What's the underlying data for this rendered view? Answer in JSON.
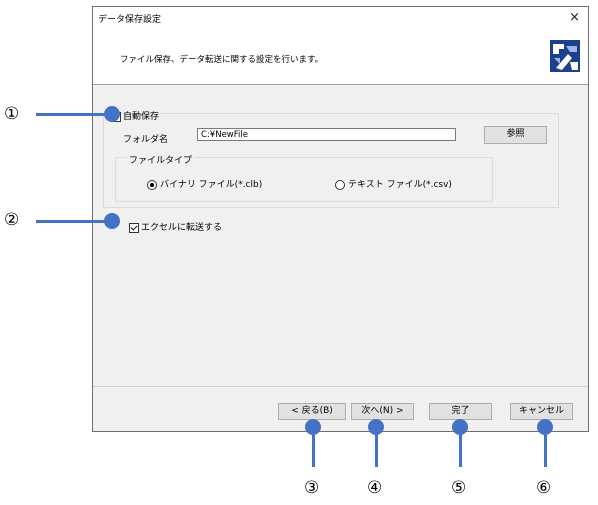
{
  "dialog": {
    "title": "データ保存設定",
    "close": "×",
    "description": "ファイル保存、データ転送に関する設定を行います。",
    "logo": "app-logo-icon"
  },
  "auto_save": {
    "label": "自動保存",
    "checked": true
  },
  "folder": {
    "label": "フォルダ名",
    "value": "C:¥NewFile",
    "browse_label": "参照"
  },
  "file_type": {
    "label": "ファイルタイプ",
    "options": [
      {
        "label": "バイナリ ファイル(*.clb)",
        "selected": true
      },
      {
        "label": "テキスト ファイル(*.csv)",
        "selected": false
      }
    ]
  },
  "excel": {
    "label": "エクセルに転送する",
    "checked": true
  },
  "buttons": {
    "back": "< 戻る(B)",
    "next": "次へ(N) >",
    "finish": "完了",
    "cancel": "キャンセル"
  },
  "callouts": [
    "①",
    "②",
    "③",
    "④",
    "⑤",
    "⑥"
  ],
  "colors": {
    "callout": "#4472c4",
    "dialog_bg": "#f0f0f0"
  }
}
